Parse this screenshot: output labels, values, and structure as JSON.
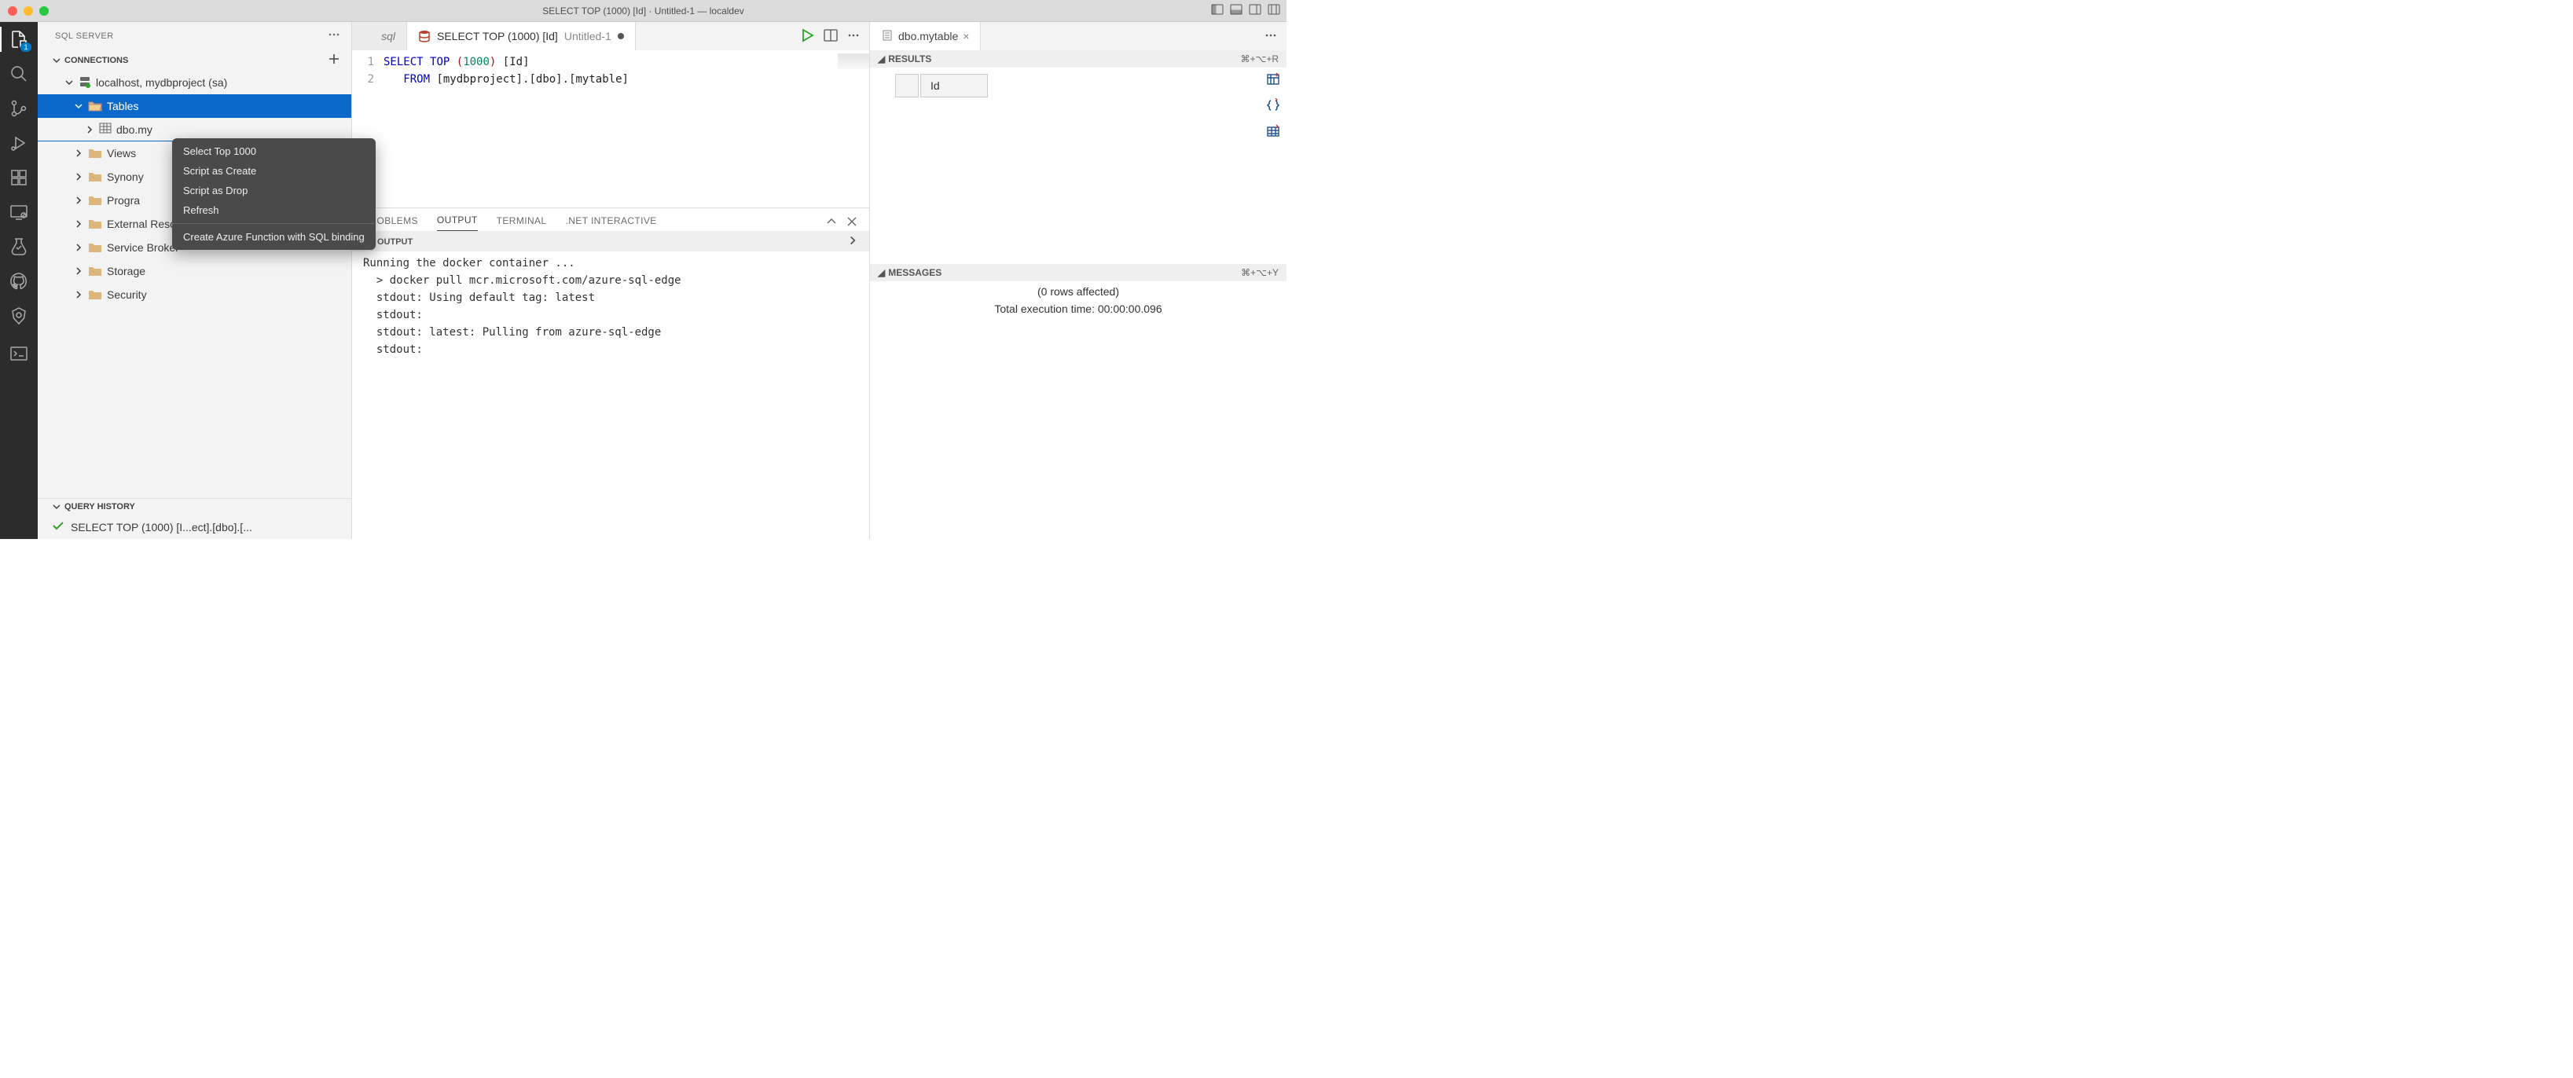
{
  "window": {
    "title": "SELECT TOP (1000) [Id] · Untitled-1 — localdev"
  },
  "activity": {
    "explorer_badge": "1"
  },
  "sidebar": {
    "title": "SQL SERVER",
    "sections": {
      "connections": "CONNECTIONS",
      "query_history": "QUERY HISTORY"
    },
    "connection": "localhost, mydbproject (sa)",
    "tree": {
      "tables": "Tables",
      "dbo_table": "dbo.my",
      "views": "Views",
      "synonyms": "Synony",
      "programmability": "Progra",
      "external_resources": "External Resources",
      "service_broker": "Service Broker",
      "storage": "Storage",
      "security": "Security"
    },
    "history_item": "SELECT TOP (1000) [I...ect].[dbo].[..."
  },
  "context_menu": {
    "select_top": "Select Top 1000",
    "script_create": "Script as Create",
    "script_drop": "Script as Drop",
    "refresh": "Refresh",
    "azure_fn": "Create Azure Function with SQL binding"
  },
  "tabs": {
    "partial_visible": "sql",
    "main": {
      "title": "SELECT TOP (1000) [Id]",
      "subtitle": "Untitled-1"
    },
    "right": "dbo.mytable"
  },
  "code": {
    "line1_select": "SELECT",
    "line1_top": "TOP",
    "line1_paren_open": "(",
    "line1_num": "1000",
    "line1_paren_close": ")",
    "line1_id": "[Id]",
    "line2_from": "FROM",
    "line2_db": "[mydbproject]",
    "line2_dot1": ".",
    "line2_schema": "[dbo]",
    "line2_dot2": ".",
    "line2_table": "[mytable]",
    "ln1": "1",
    "ln2": "2"
  },
  "results": {
    "header": "RESULTS",
    "shortcut": "⌘+⌥+R",
    "col": "Id",
    "messages_header": "MESSAGES",
    "messages_shortcut": "⌘+⌥+Y",
    "rows_affected": "(0 rows affected)",
    "exec_time": "Total execution time: 00:00:00.096"
  },
  "panel": {
    "problems": "PROBLEMS",
    "output": "OUTPUT",
    "terminal": "TERMINAL",
    "dotnet": ".NET INTERACTIVE",
    "output_section": "OUTPUT",
    "lines": [
      "Running the docker container ...",
      "  > docker pull mcr.microsoft.com/azure-sql-edge",
      "  stdout: Using default tag: latest",
      "  stdout:",
      "  stdout: latest: Pulling from azure-sql-edge",
      "  stdout:"
    ]
  }
}
